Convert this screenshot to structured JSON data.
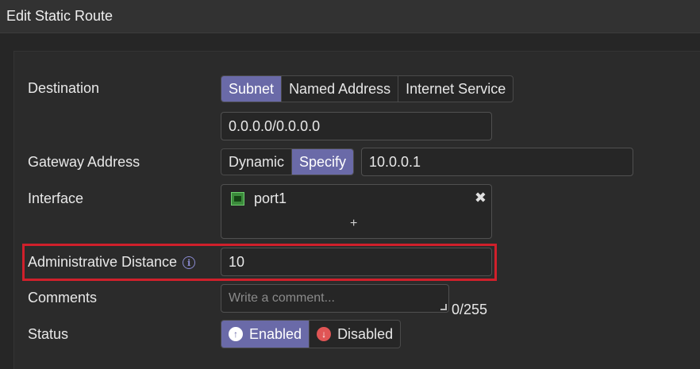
{
  "window": {
    "title": "Edit Static Route"
  },
  "destination": {
    "label": "Destination",
    "options": [
      "Subnet",
      "Named Address",
      "Internet Service"
    ],
    "selected": "Subnet",
    "value": "0.0.0.0/0.0.0.0"
  },
  "gateway": {
    "label": "Gateway Address",
    "options": [
      "Dynamic",
      "Specify"
    ],
    "selected": "Specify",
    "value": "10.0.0.1"
  },
  "interface": {
    "label": "Interface",
    "items": [
      {
        "name": "port1",
        "icon": "port-icon"
      }
    ],
    "remove_symbol": "✖",
    "add_symbol": "+"
  },
  "admin_distance": {
    "label": "Administrative Distance",
    "info_symbol": "i",
    "value": "10"
  },
  "comments": {
    "label": "Comments",
    "placeholder": "Write a comment...",
    "counter": "0/255"
  },
  "status": {
    "label": "Status",
    "options": [
      "Enabled",
      "Disabled"
    ],
    "selected": "Enabled",
    "enabled_symbol": "↑",
    "disabled_symbol": "↓"
  },
  "colors": {
    "accent": "#6a6aa8",
    "highlight": "#d0202b",
    "port_icon": "#3c8c3c",
    "disabled_icon": "#e05555"
  }
}
